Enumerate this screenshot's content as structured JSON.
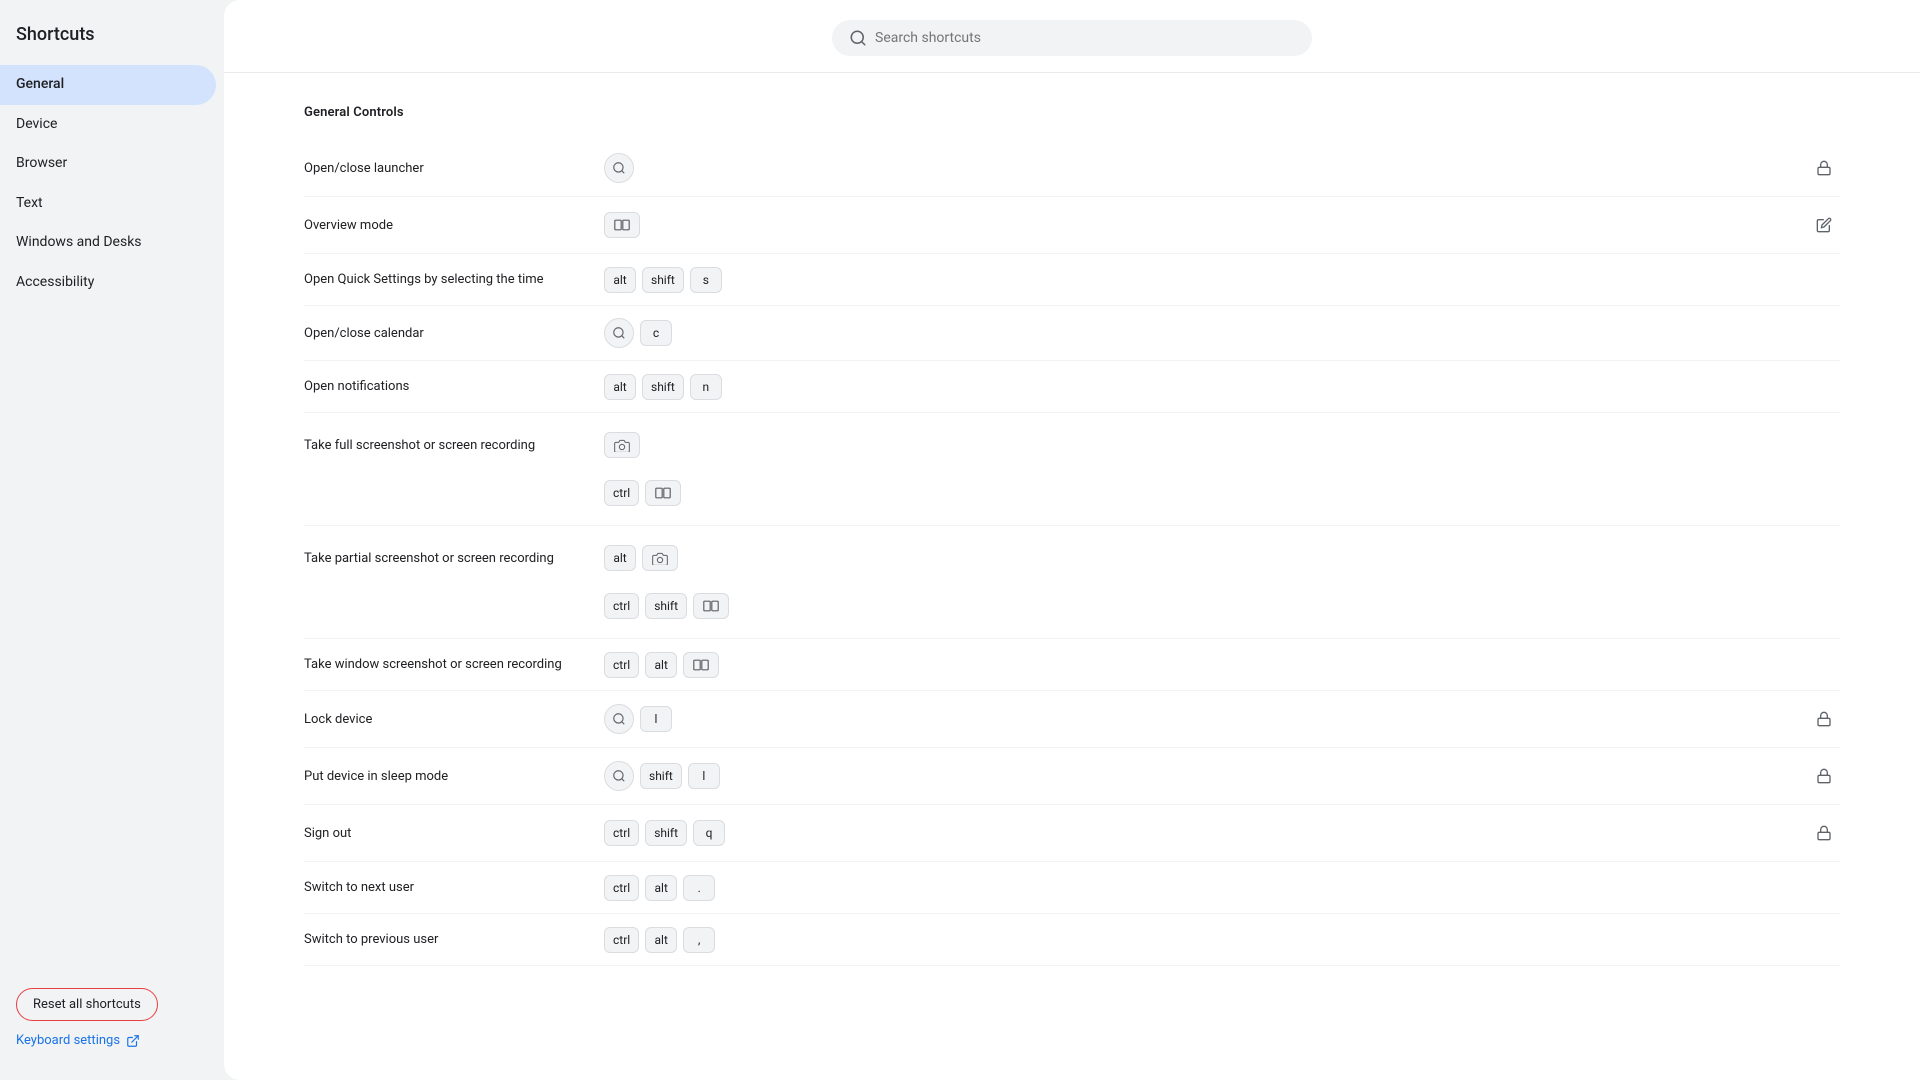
{
  "app": {
    "title": "Shortcuts"
  },
  "search": {
    "placeholder": "Search shortcuts",
    "value": ""
  },
  "sidebar": {
    "items": [
      {
        "id": "general",
        "label": "General",
        "active": true
      },
      {
        "id": "device",
        "label": "Device",
        "active": false
      },
      {
        "id": "browser",
        "label": "Browser",
        "active": false
      },
      {
        "id": "text",
        "label": "Text",
        "active": false
      },
      {
        "id": "windows-and-desks",
        "label": "Windows and Desks",
        "active": false
      },
      {
        "id": "accessibility",
        "label": "Accessibility",
        "active": false
      }
    ],
    "reset_label": "Reset all shortcuts",
    "keyboard_settings_label": "Keyboard settings"
  },
  "main": {
    "section_title": "General Controls",
    "shortcuts": [
      {
        "id": "open-close-launcher",
        "label": "Open/close launcher",
        "keys": [
          {
            "type": "circle-icon",
            "value": "search"
          }
        ],
        "action": "lock"
      },
      {
        "id": "overview-mode",
        "label": "Overview mode",
        "keys": [
          {
            "type": "rect-icon",
            "value": "overview"
          }
        ],
        "action": "edit"
      },
      {
        "id": "open-quick-settings",
        "label": "Open Quick Settings by selecting the time",
        "keys": [
          {
            "type": "badge",
            "value": "alt"
          },
          {
            "type": "badge",
            "value": "shift"
          },
          {
            "type": "badge",
            "value": "s"
          }
        ],
        "action": null
      },
      {
        "id": "open-close-calendar",
        "label": "Open/close calendar",
        "keys": [
          {
            "type": "circle-icon",
            "value": "search"
          },
          {
            "type": "badge",
            "value": "c"
          }
        ],
        "action": null
      },
      {
        "id": "open-notifications",
        "label": "Open notifications",
        "keys": [
          {
            "type": "badge",
            "value": "alt"
          },
          {
            "type": "badge",
            "value": "shift"
          },
          {
            "type": "badge",
            "value": "n"
          }
        ],
        "action": null
      },
      {
        "id": "screenshot-full",
        "label": "Take full screenshot or screen recording",
        "keys_row1": [
          {
            "type": "rect-icon",
            "value": "camera"
          }
        ],
        "keys_row2": [
          {
            "type": "badge",
            "value": "ctrl"
          },
          {
            "type": "rect-icon",
            "value": "overview"
          }
        ],
        "action": null,
        "multi_row": true
      },
      {
        "id": "screenshot-partial",
        "label": "Take partial screenshot or screen recording",
        "keys_row1": [
          {
            "type": "badge",
            "value": "alt"
          },
          {
            "type": "rect-icon",
            "value": "camera"
          }
        ],
        "keys_row2": [
          {
            "type": "badge",
            "value": "ctrl"
          },
          {
            "type": "badge",
            "value": "shift"
          },
          {
            "type": "rect-icon",
            "value": "overview"
          }
        ],
        "action": null,
        "multi_row": true
      },
      {
        "id": "screenshot-window",
        "label": "Take window screenshot or screen recording",
        "keys": [
          {
            "type": "badge",
            "value": "ctrl"
          },
          {
            "type": "badge",
            "value": "alt"
          },
          {
            "type": "rect-icon",
            "value": "overview"
          }
        ],
        "action": null
      },
      {
        "id": "lock-device",
        "label": "Lock device",
        "keys": [
          {
            "type": "circle-icon",
            "value": "search"
          },
          {
            "type": "badge",
            "value": "l"
          }
        ],
        "action": "lock"
      },
      {
        "id": "sleep-mode",
        "label": "Put device in sleep mode",
        "keys": [
          {
            "type": "circle-icon",
            "value": "search"
          },
          {
            "type": "badge",
            "value": "shift"
          },
          {
            "type": "badge",
            "value": "l"
          }
        ],
        "action": "lock"
      },
      {
        "id": "sign-out",
        "label": "Sign out",
        "keys": [
          {
            "type": "badge",
            "value": "ctrl"
          },
          {
            "type": "badge",
            "value": "shift"
          },
          {
            "type": "badge",
            "value": "q"
          }
        ],
        "action": "lock"
      },
      {
        "id": "switch-next-user",
        "label": "Switch to next user",
        "keys": [
          {
            "type": "badge",
            "value": "ctrl"
          },
          {
            "type": "badge",
            "value": "alt"
          },
          {
            "type": "badge",
            "value": "."
          }
        ],
        "action": null
      },
      {
        "id": "switch-prev-user",
        "label": "Switch to previous user",
        "keys": [
          {
            "type": "badge",
            "value": "ctrl"
          },
          {
            "type": "badge",
            "value": "alt"
          },
          {
            "type": "badge",
            "value": ","
          }
        ],
        "action": null
      }
    ]
  }
}
